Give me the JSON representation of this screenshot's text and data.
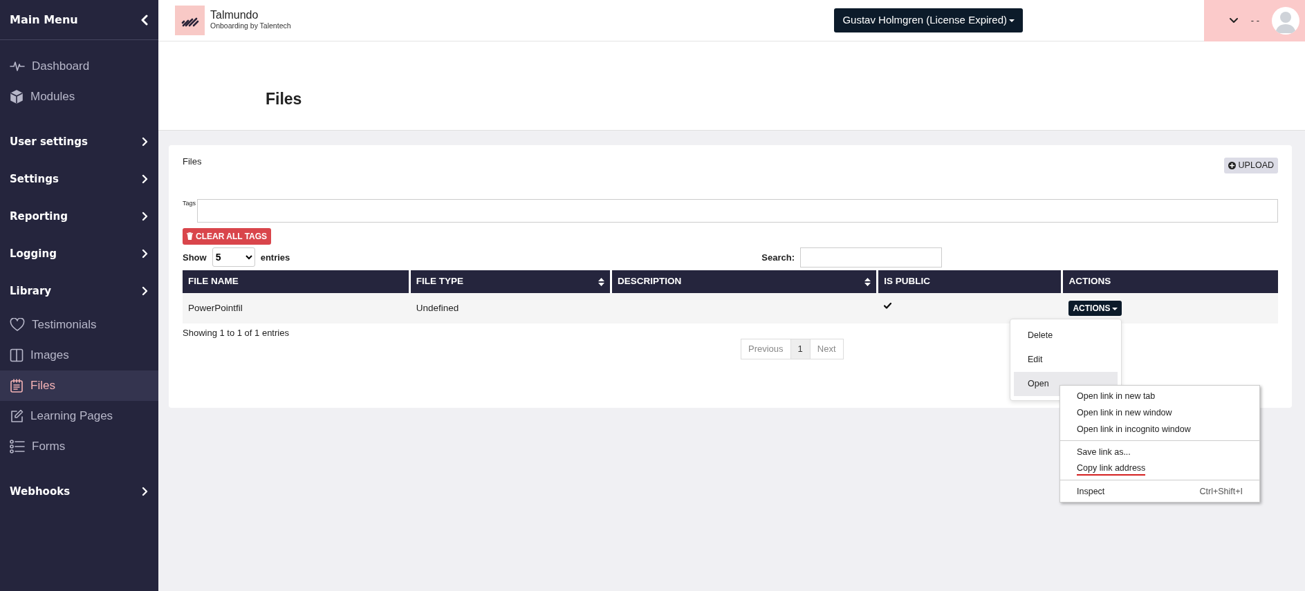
{
  "sidebar": {
    "title": "Main Menu",
    "items": [
      {
        "kind": "link",
        "label": "Dashboard",
        "selected": false
      },
      {
        "kind": "link",
        "label": "Modules",
        "selected": false
      },
      {
        "kind": "section",
        "label": "User settings",
        "selected": false
      },
      {
        "kind": "section",
        "label": "Settings",
        "selected": false
      },
      {
        "kind": "section",
        "label": "Reporting",
        "selected": false
      },
      {
        "kind": "section",
        "label": "Logging",
        "selected": false
      },
      {
        "kind": "section",
        "label": "Library",
        "selected": false
      },
      {
        "kind": "link",
        "label": "Testimonials",
        "selected": false
      },
      {
        "kind": "link",
        "label": "Images",
        "selected": false
      },
      {
        "kind": "link",
        "label": "Files",
        "selected": true
      },
      {
        "kind": "link",
        "label": "Learning Pages",
        "selected": false
      },
      {
        "kind": "link",
        "label": "Forms",
        "selected": false
      },
      {
        "kind": "section",
        "label": "Webhooks",
        "selected": false
      }
    ]
  },
  "header": {
    "brand": {
      "name": "Talmundo",
      "tagline": "Onboarding by Talentech"
    },
    "user_button": "Gustav Holmgren (License Expired)",
    "user_name": "- -"
  },
  "page_title": "Files",
  "card": {
    "title": "Files",
    "upload_button": "UPLOAD",
    "tags_label": "Tags",
    "clear_tags_button": "CLEAR ALL TAGS",
    "length": {
      "prefix": "Show",
      "value": "5",
      "suffix": "entries"
    },
    "search_label": "Search:",
    "table": {
      "columns": [
        {
          "label": "FILE NAME",
          "sortable": false
        },
        {
          "label": "FILE TYPE",
          "sortable": true
        },
        {
          "label": "DESCRIPTION",
          "sortable": true
        },
        {
          "label": "IS PUBLIC",
          "sortable": false
        },
        {
          "label": "ACTIONS",
          "sortable": false
        }
      ],
      "rows": [
        {
          "file_name": "PowerPointfil",
          "file_type": "Undefined",
          "is_public": true,
          "actions_button": "ACTIONS"
        }
      ]
    },
    "info": "Showing 1 to 1 of 1 entries",
    "pagination": [
      {
        "label": "Previous",
        "disabled": true,
        "selected": false
      },
      {
        "label": "1",
        "disabled": false,
        "selected": true
      },
      {
        "label": "Next",
        "disabled": true,
        "selected": false
      }
    ]
  },
  "actions_menu": [
    {
      "label": "Delete",
      "selected": false
    },
    {
      "label": "Edit",
      "selected": false
    },
    {
      "label": "Open",
      "selected": true
    }
  ],
  "context_menu": {
    "groups": [
      [
        {
          "label": "Open link in new tab",
          "underlined": false
        },
        {
          "label": "Open link in new window",
          "underlined": false
        },
        {
          "label": "Open link in incognito window",
          "underlined": false
        }
      ],
      [
        {
          "label": "Save link as...",
          "underlined": false
        },
        {
          "label": "Copy link address",
          "underlined": true
        }
      ],
      [
        {
          "label": "Inspect",
          "shortcut": "Ctrl+Shift+I",
          "underlined": false
        }
      ]
    ]
  }
}
